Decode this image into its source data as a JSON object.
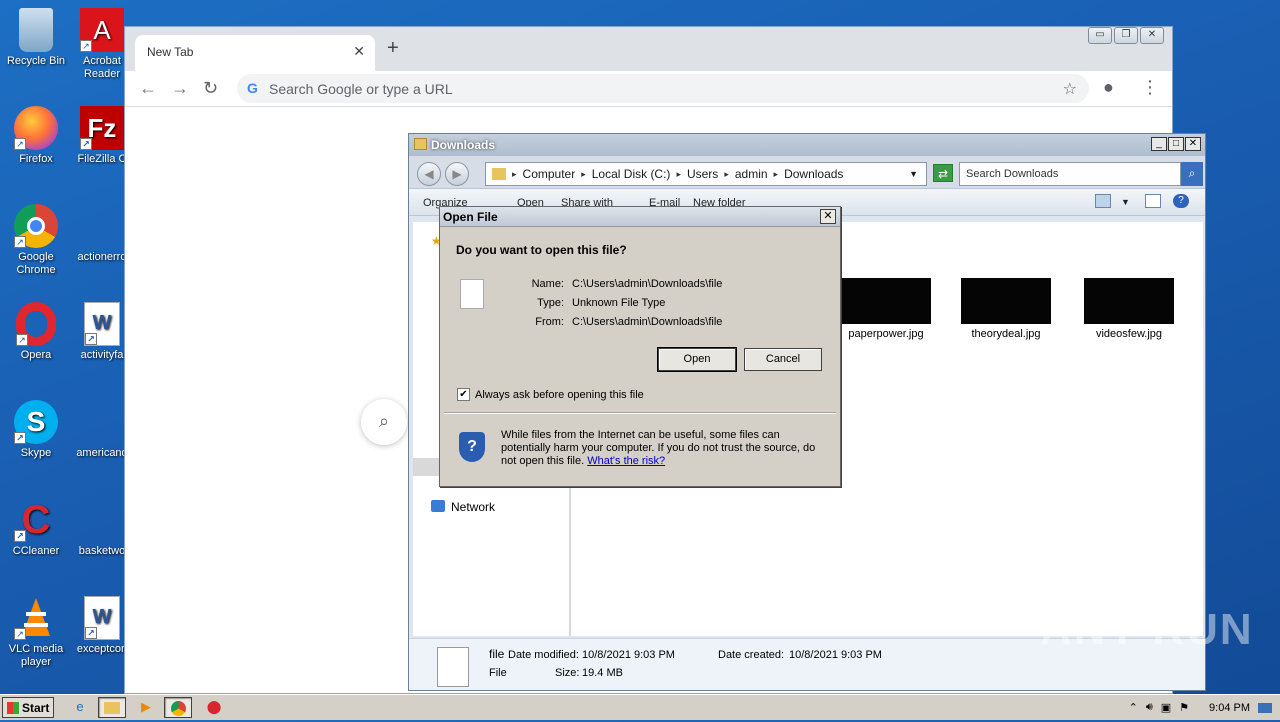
{
  "desktop": {
    "icons": [
      {
        "label": "Recycle Bin"
      },
      {
        "label": "Acrobat Reader"
      },
      {
        "label": "Firefox"
      },
      {
        "label": "FileZilla C"
      },
      {
        "label": "Google Chrome"
      },
      {
        "label": "actionerro"
      },
      {
        "label": "Opera"
      },
      {
        "label": "activityfa"
      },
      {
        "label": "Skype"
      },
      {
        "label": "americand"
      },
      {
        "label": "CCleaner"
      },
      {
        "label": "basketwo"
      },
      {
        "label": "VLC media player"
      },
      {
        "label": "exceptcon"
      }
    ]
  },
  "chrome": {
    "tab_title": "New Tab",
    "omnibox_placeholder": "Search Google or type a URL"
  },
  "explorer": {
    "title": "Downloads",
    "breadcrumb": [
      "Computer",
      "Local Disk (C:)",
      "Users",
      "admin",
      "Downloads"
    ],
    "search_placeholder": "Search Downloads",
    "commands": [
      "Organize",
      "Open",
      "Share with",
      "E-mail",
      "New folder"
    ],
    "nav_network": "Network",
    "files": [
      {
        "name": "paperpower.jpg"
      },
      {
        "name": "theorydeal.jpg"
      },
      {
        "name": "videosfew.jpg"
      }
    ],
    "details": {
      "name": "file",
      "type": "File",
      "date_modified_label": "Date modified:",
      "date_modified": "10/8/2021 9:03 PM",
      "date_created_label": "Date created:",
      "date_created": "10/8/2021 9:03 PM",
      "size_label": "Size:",
      "size": "19.4 MB"
    }
  },
  "dialog": {
    "title": "Open File",
    "question": "Do you want to open this file?",
    "name_label": "Name:",
    "name_value": "C:\\Users\\admin\\Downloads\\file",
    "type_label": "Type:",
    "type_value": "Unknown File Type",
    "from_label": "From:",
    "from_value": "C:\\Users\\admin\\Downloads\\file",
    "open_label": "Open",
    "cancel_label": "Cancel",
    "checkbox_label": "Always ask before opening this file",
    "checkbox_checked": true,
    "warning_text": "While files from the Internet can be useful, some files can potentially harm your computer. If you do not trust the source, do not open this file.",
    "risk_link": "What's the risk?"
  },
  "taskbar": {
    "start_label": "Start",
    "clock": "9:04 PM"
  },
  "watermark": "ANY RUN",
  "colors": {
    "desktop": "#1a5fb3",
    "dialog_bg": "#d4d0c8",
    "link": "#0000cc"
  }
}
